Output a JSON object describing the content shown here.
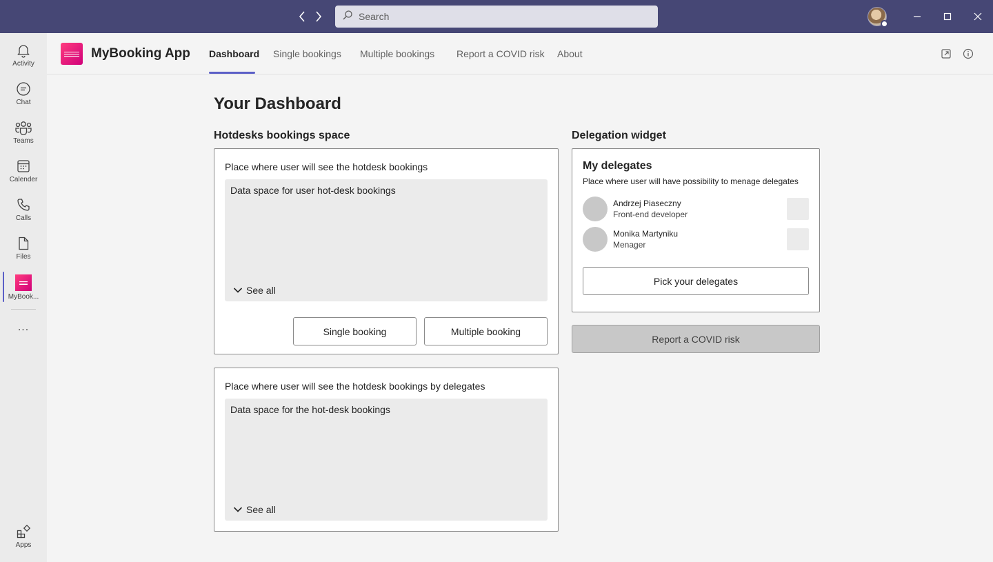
{
  "titlebar": {
    "search_placeholder": "Search",
    "accent": "#464775"
  },
  "rail": {
    "items": [
      {
        "label": "Activity",
        "icon": "bell-icon"
      },
      {
        "label": "Chat",
        "icon": "chat-icon"
      },
      {
        "label": "Teams",
        "icon": "teams-icon"
      },
      {
        "label": "Calender",
        "icon": "calendar-icon"
      },
      {
        "label": "Calls",
        "icon": "phone-icon"
      },
      {
        "label": "Files",
        "icon": "file-icon"
      },
      {
        "label": "MyBook...",
        "icon": "mybooking-app-icon",
        "active": true
      }
    ],
    "more": "...",
    "apps_label": "Apps"
  },
  "header": {
    "app_title": "MyBooking App",
    "tabs": [
      {
        "label": "Dashboard",
        "active": true
      },
      {
        "label": "Single bookings"
      },
      {
        "label": "Multiple bookings"
      },
      {
        "label": "Report a COVID risk"
      },
      {
        "label": "About"
      }
    ]
  },
  "main": {
    "page_title": "Your Dashboard",
    "hotdesks": {
      "section_title": "Hotdesks bookings space",
      "card1": {
        "caption": "Place where user will see the hotdesk bookings",
        "data_text": "Data space for user hot-desk bookings",
        "see_all": "See all",
        "single_button": "Single booking",
        "multiple_button": "Multiple booking"
      },
      "card2": {
        "caption": "Place where user will see the hotdesk bookings by delegates",
        "data_text": "Data space for the hot-desk bookings",
        "see_all": "See all"
      }
    },
    "delegation": {
      "section_title": "Delegation widget",
      "title": "My delegates",
      "subtitle": "Place where user will have possibility to menage delegates",
      "people": [
        {
          "name": "Andrzej Piaseczny",
          "role": "Front-end developer"
        },
        {
          "name": "Monika Martyniku",
          "role": "Menager"
        }
      ],
      "pick_button": "Pick your delegates"
    },
    "covid_button": "Report a COVID risk"
  }
}
